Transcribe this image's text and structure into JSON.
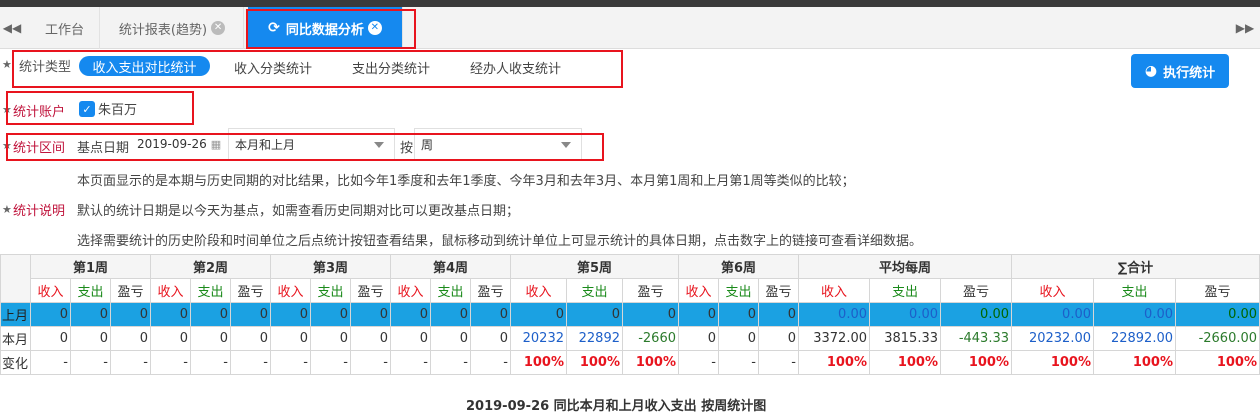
{
  "tabs": [
    {
      "label": "工作台",
      "closable": false
    },
    {
      "label": "统计报表(趋势)",
      "closable": true
    },
    {
      "label": "同比数据分析",
      "closable": true,
      "active": true
    }
  ],
  "stat_type": {
    "label": "统计类型",
    "options": [
      "收入支出对比统计",
      "收入分类统计",
      "支出分类统计",
      "经办人收支统计"
    ],
    "selected": "收入支出对比统计"
  },
  "run_button": "执行统计",
  "account": {
    "label": "统计账户",
    "name": "朱百万",
    "checked": true
  },
  "range": {
    "label": "统计区间",
    "base_label": "基点日期",
    "base_date": "2019-09-26",
    "period": "本月和上月",
    "by_label": "按",
    "unit": "周"
  },
  "desc": {
    "label": "统计说明",
    "lines": [
      "本页面显示的是本期与历史同期的对比结果，比如今年1季度和去年1季度、今年3月和去年3月、本月第1周和上月第1周等类似的比较；",
      "默认的统计日期是以今天为基点，如需查看历史同期对比可以更改基点日期；",
      "选择需要统计的历史阶段和时间单位之后点统计按钮查看结果，鼠标移动到统计单位上可显示统计的具体日期，点击数字上的链接可查看详细数据。"
    ]
  },
  "table": {
    "groups": [
      "第1周",
      "第2周",
      "第3周",
      "第4周",
      "第5周",
      "第6周",
      "平均每周",
      "∑合计"
    ],
    "sub": [
      "收入",
      "支出",
      "盈亏"
    ],
    "rows": [
      {
        "label": "上月",
        "cells": [
          "0",
          "0",
          "0",
          "0",
          "0",
          "0",
          "0",
          "0",
          "0",
          "0",
          "0",
          "0",
          "0",
          "0",
          "0",
          "0",
          "0",
          "0",
          "0.00",
          "0.00",
          "0.00",
          "0.00",
          "0.00",
          "0.00"
        ]
      },
      {
        "label": "本月",
        "cells": [
          "0",
          "0",
          "0",
          "0",
          "0",
          "0",
          "0",
          "0",
          "0",
          "0",
          "0",
          "0",
          "20232",
          "22892",
          "-2660",
          "0",
          "0",
          "0",
          "3372.00",
          "3815.33",
          "-443.33",
          "20232.00",
          "22892.00",
          "-2660.00"
        ]
      },
      {
        "label": "变化",
        "cells": [
          "-",
          "-",
          "-",
          "-",
          "-",
          "-",
          "-",
          "-",
          "-",
          "-",
          "-",
          "-",
          "100%",
          "100%",
          "100%",
          "-",
          "-",
          "-",
          "100%",
          "100%",
          "100%",
          "100%",
          "100%",
          "100%"
        ]
      }
    ]
  },
  "bottom_title": "2019-09-26 同比本月和上月收入支出 按周统计图"
}
